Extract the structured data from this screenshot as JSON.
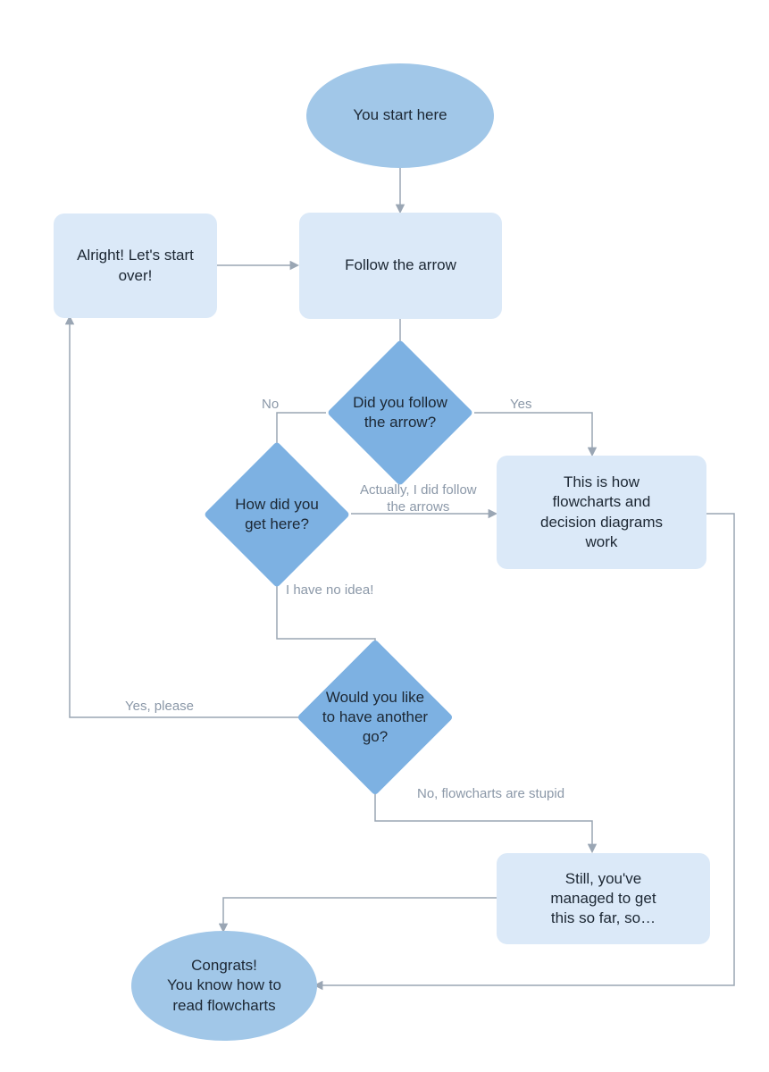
{
  "nodes": {
    "start": {
      "text": "You start here"
    },
    "startOver": {
      "text": "Alright! Let's start\nover!"
    },
    "follow": {
      "text": "Follow the arrow"
    },
    "didFollow": {
      "text": "Did you follow\nthe arrow?"
    },
    "howHere": {
      "text": "How did you\nget here?"
    },
    "thisIsHow": {
      "text": "This is how\nflowcharts and\ndecision diagrams\nwork"
    },
    "anotherGo": {
      "text": "Would you like\nto have another\ngo?"
    },
    "stillManaged": {
      "text": "Still, you've\nmanaged to get\nthis so far, so…"
    },
    "congrats": {
      "text": "Congrats!\nYou know how to\nread flowcharts"
    }
  },
  "edgeLabels": {
    "no": "No",
    "yes": "Yes",
    "actually": "Actually, I did follow\nthe arrows",
    "noIdea": "I have no idea!",
    "yesPlease": "Yes, please",
    "noStupid": "No, flowcharts are stupid"
  },
  "colors": {
    "ellipse": "#a1c7e8",
    "process": "#dbe9f8",
    "diamond": "#7db1e2",
    "arrow": "#9aa6b4",
    "label": "#8b98a8",
    "text": "#1c2733"
  }
}
